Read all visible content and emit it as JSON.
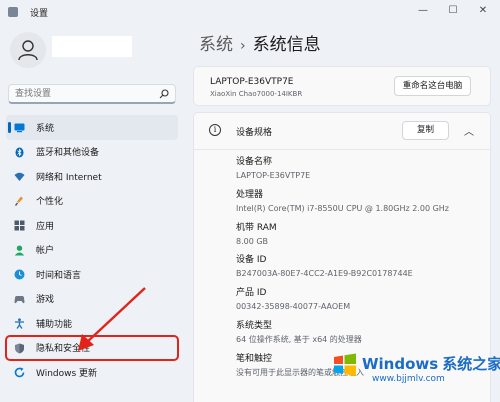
{
  "window": {
    "title": "设置",
    "minimize": "—",
    "maximize": "☐",
    "close": "✕"
  },
  "search": {
    "placeholder": "查找设置"
  },
  "nav": {
    "items": [
      {
        "label": "系统",
        "icon": "system-icon",
        "color": "#0078d4"
      },
      {
        "label": "蓝牙和其他设备",
        "icon": "bluetooth-icon",
        "color": "#0067c0"
      },
      {
        "label": "网络和 Internet",
        "icon": "wifi-icon",
        "color": "#2b6fb6"
      },
      {
        "label": "个性化",
        "icon": "brush-icon",
        "color": "#e8912d"
      },
      {
        "label": "应用",
        "icon": "apps-icon",
        "color": "#4d5a6c"
      },
      {
        "label": "帐户",
        "icon": "account-icon",
        "color": "#1fa862"
      },
      {
        "label": "时间和语言",
        "icon": "globe-clock-icon",
        "color": "#1b8fd6"
      },
      {
        "label": "游戏",
        "icon": "gamepad-icon",
        "color": "#6c7686"
      },
      {
        "label": "辅助功能",
        "icon": "accessibility-icon",
        "color": "#1f6fb8"
      },
      {
        "label": "隐私和安全性",
        "icon": "shield-icon",
        "color": "#7a8696"
      },
      {
        "label": "Windows 更新",
        "icon": "update-icon",
        "color": "#0078d4"
      }
    ]
  },
  "header": {
    "parent": "系统",
    "separator": "›",
    "title": "系统信息"
  },
  "device": {
    "name": "LAPTOP-E36VTP7E",
    "model": "XiaoXin Chao7000-14IKBR",
    "rename_label": "重命名这台电脑"
  },
  "specs": {
    "title": "设备规格",
    "copy_label": "复制",
    "rows": [
      {
        "label": "设备名称",
        "value": "LAPTOP-E36VTP7E"
      },
      {
        "label": "处理器",
        "value": "Intel(R) Core(TM) i7-8550U CPU @ 1.80GHz   2.00 GHz"
      },
      {
        "label": "机带 RAM",
        "value": "8.00 GB"
      },
      {
        "label": "设备 ID",
        "value": "B247003A-80E7-4CC2-A1E9-B92C0178744E"
      },
      {
        "label": "产品 ID",
        "value": "00342-35898-40077-AAOEM"
      },
      {
        "label": "系统类型",
        "value": "64 位操作系统, 基于 x64 的处理器"
      },
      {
        "label": "笔和触控",
        "value": "没有可用于此显示器的笔或触控输入"
      }
    ]
  },
  "watermark": {
    "brand": "Windows",
    "brand_cn": "系统之家",
    "url": "www.bjjmlv.com"
  }
}
